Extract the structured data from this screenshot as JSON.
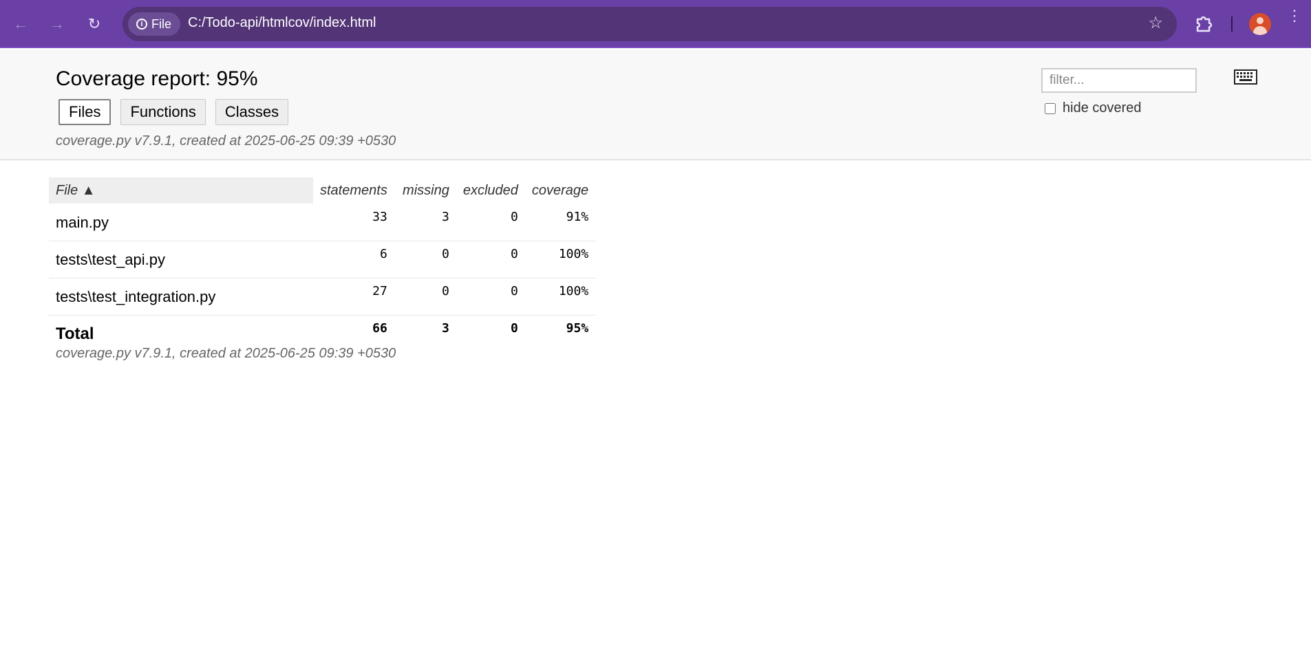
{
  "browser": {
    "chip_label": "File",
    "url": "C:/Todo-api/htmlcov/index.html"
  },
  "header": {
    "title": "Coverage report: 95%",
    "nav": {
      "files": "Files",
      "functions": "Functions",
      "classes": "Classes"
    },
    "created": "coverage.py v7.9.1, created at 2025-06-25 09:39 +0530",
    "filter_placeholder": "filter...",
    "hide_covered_label": "hide covered"
  },
  "table": {
    "columns": {
      "file": "File ▲",
      "statements": "statements",
      "missing": "missing",
      "excluded": "excluded",
      "coverage": "coverage"
    },
    "rows": [
      {
        "file": "main.py",
        "statements": "33",
        "missing": "3",
        "excluded": "0",
        "coverage": "91%"
      },
      {
        "file": "tests\\test_api.py",
        "statements": "6",
        "missing": "0",
        "excluded": "0",
        "coverage": "100%"
      },
      {
        "file": "tests\\test_integration.py",
        "statements": "27",
        "missing": "0",
        "excluded": "0",
        "coverage": "100%"
      }
    ],
    "total": {
      "file": "Total",
      "statements": "66",
      "missing": "3",
      "excluded": "0",
      "coverage": "95%"
    }
  },
  "footer": {
    "created": "coverage.py v7.9.1, created at 2025-06-25 09:39 +0530"
  },
  "colors": {
    "toolbar": "#6a3fa6",
    "omnibox": "#523477",
    "header_bg": "#f8f8f8"
  }
}
